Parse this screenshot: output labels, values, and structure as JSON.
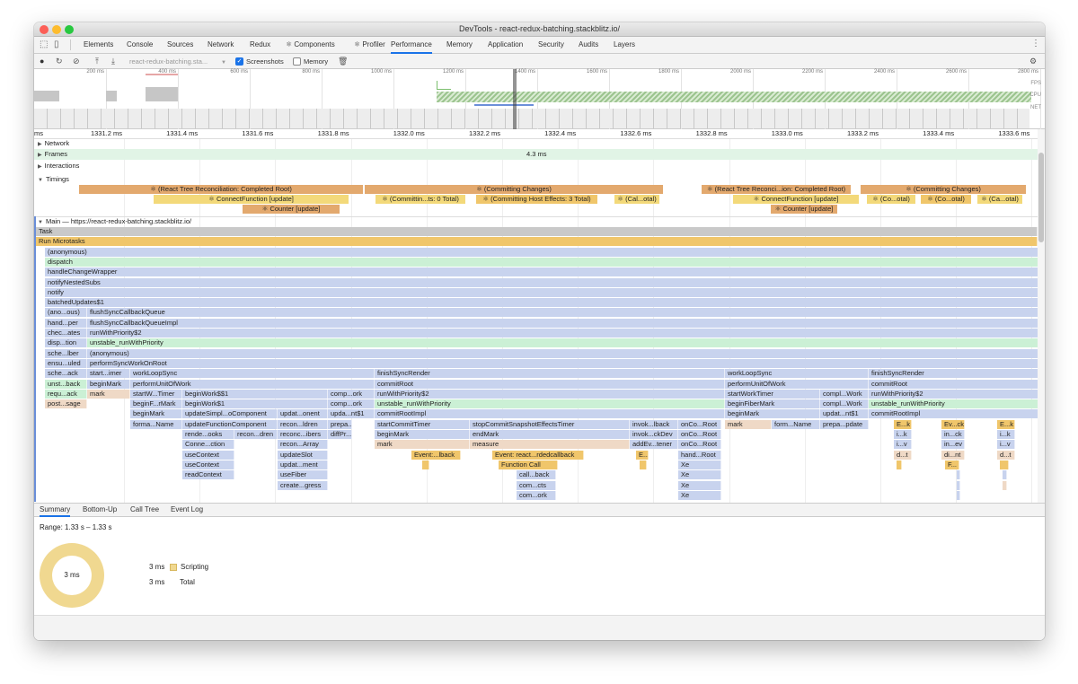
{
  "window": {
    "title": "DevTools - react-redux-batching.stackblitz.io/"
  },
  "tabs": [
    "Elements",
    "Console",
    "Sources",
    "Network",
    "Redux",
    "⚛ Components",
    "⚛ Profiler",
    "Performance",
    "Memory",
    "Application",
    "Security",
    "Audits",
    "Layers"
  ],
  "toolbar": {
    "url": "react-redux-batching.sta...",
    "screenshots": "Screenshots",
    "memory": "Memory"
  },
  "overview": {
    "ticks": [
      "200 ms",
      "400 ms",
      "600 ms",
      "800 ms",
      "1000 ms",
      "1200 ms",
      "1400 ms",
      "1600 ms",
      "1800 ms",
      "2000 ms",
      "2200 ms",
      "2400 ms",
      "2600 ms",
      "2800 ms"
    ],
    "fps": "FPS",
    "cpu": "CPU",
    "net": "NET"
  },
  "ruler": [
    "ms",
    "1331.2 ms",
    "1331.4 ms",
    "1331.6 ms",
    "1331.8 ms",
    "1332.0 ms",
    "1332.2 ms",
    "1332.4 ms",
    "1332.6 ms",
    "1332.8 ms",
    "1333.0 ms",
    "1333.2 ms",
    "1333.4 ms",
    "1333.6 ms"
  ],
  "tracks": {
    "network": "Network",
    "frames": "Frames",
    "frames_duration": "4.3 ms",
    "interactions": "Interactions",
    "timings": "Timings",
    "main": "Main — https://react-redux-batching.stackblitz.io/"
  },
  "timings": [
    {
      "row": 0,
      "l": 50,
      "w": 316,
      "t": "⚛ (React Tree Reconciliation: Completed Root)",
      "c": "#e3a96e"
    },
    {
      "row": 0,
      "l": 368,
      "w": 332,
      "t": "⚛ (Committing Changes)",
      "c": "#e3a96e"
    },
    {
      "row": 0,
      "l": 743,
      "w": 166,
      "t": "⚛ (React Tree Reconci...ion: Completed Root)",
      "c": "#e3a96e"
    },
    {
      "row": 0,
      "l": 920,
      "w": 184,
      "t": "⚛ (Committing Changes)",
      "c": "#e3a96e"
    },
    {
      "row": 1,
      "l": 133,
      "w": 217,
      "t": "⚛ ConnectFunction [update]",
      "c": "#f3d97a"
    },
    {
      "row": 1,
      "l": 380,
      "w": 100,
      "t": "⚛ (Committin...ts: 0 Total)",
      "c": "#f3d97a"
    },
    {
      "row": 1,
      "l": 492,
      "w": 135,
      "t": "⚛ (Committing Host Effects: 3 Total)",
      "c": "#f0c66b"
    },
    {
      "row": 1,
      "l": 646,
      "w": 50,
      "t": "⚛ (Cal...otal)",
      "c": "#f3d97a"
    },
    {
      "row": 1,
      "l": 778,
      "w": 140,
      "t": "⚛ ConnectFunction [update]",
      "c": "#f3d97a"
    },
    {
      "row": 1,
      "l": 927,
      "w": 54,
      "t": "⚛ (Co...otal)",
      "c": "#f3d97a"
    },
    {
      "row": 1,
      "l": 987,
      "w": 56,
      "t": "⚛ (Co...otal)",
      "c": "#f0c66b"
    },
    {
      "row": 1,
      "l": 1050,
      "w": 50,
      "t": "⚛ (Ca...otal)",
      "c": "#f3d97a"
    },
    {
      "row": 2,
      "l": 232,
      "w": 108,
      "t": "⚛ Counter [update]",
      "c": "#e3a96e"
    },
    {
      "row": 2,
      "l": 820,
      "w": 74,
      "t": "⚛ Counter [update]",
      "c": "#e3a96e"
    }
  ],
  "flame": [
    {
      "row": 0,
      "l": 0,
      "w": 1117,
      "t": "Task",
      "c": "gy"
    },
    {
      "row": 1,
      "l": 0,
      "w": 1117,
      "t": "Run Microtasks",
      "c": "or"
    },
    {
      "row": 2,
      "l": 10,
      "w": 1107,
      "t": "(anonymous)",
      "c": "bl"
    },
    {
      "row": 3,
      "l": 10,
      "w": 1107,
      "t": "dispatch",
      "c": "gr"
    },
    {
      "row": 4,
      "l": 10,
      "w": 1107,
      "t": "handleChangeWrapper",
      "c": "bl"
    },
    {
      "row": 5,
      "l": 10,
      "w": 1107,
      "t": "notifyNestedSubs",
      "c": "bl"
    },
    {
      "row": 6,
      "l": 10,
      "w": 1107,
      "t": "notify",
      "c": "bl"
    },
    {
      "row": 7,
      "l": 10,
      "w": 1107,
      "t": "batchedUpdates$1",
      "c": "bl"
    },
    {
      "row": 8,
      "l": 10,
      "w": 47,
      "t": "(ano...ous)",
      "c": "bl"
    },
    {
      "row": 8,
      "l": 57,
      "w": 1060,
      "t": "flushSyncCallbackQueue",
      "c": "bl"
    },
    {
      "row": 9,
      "l": 10,
      "w": 47,
      "t": "hand...per",
      "c": "bl"
    },
    {
      "row": 9,
      "l": 57,
      "w": 1060,
      "t": "flushSyncCallbackQueueImpl",
      "c": "bl"
    },
    {
      "row": 10,
      "l": 10,
      "w": 47,
      "t": "chec...ates",
      "c": "bl"
    },
    {
      "row": 10,
      "l": 57,
      "w": 1060,
      "t": "runWithPriority$2",
      "c": "bl"
    },
    {
      "row": 11,
      "l": 10,
      "w": 47,
      "t": "disp...tion",
      "c": "bl"
    },
    {
      "row": 11,
      "l": 57,
      "w": 1060,
      "t": "unstable_runWithPriority",
      "c": "gr"
    },
    {
      "row": 12,
      "l": 10,
      "w": 47,
      "t": "sche...lber",
      "c": "bl"
    },
    {
      "row": 12,
      "l": 57,
      "w": 1060,
      "t": "(anonymous)",
      "c": "bl"
    },
    {
      "row": 13,
      "l": 10,
      "w": 47,
      "t": "ensu...uled",
      "c": "bl"
    },
    {
      "row": 13,
      "l": 57,
      "w": 1060,
      "t": "performSyncWorkOnRoot",
      "c": "bl"
    },
    {
      "row": 14,
      "l": 10,
      "w": 47,
      "t": "sche...ack",
      "c": "bl"
    },
    {
      "row": 14,
      "l": 57,
      "w": 48,
      "t": "start...imer",
      "c": "bl"
    },
    {
      "row": 14,
      "l": 105,
      "w": 272,
      "t": "workLoopSync",
      "c": "bl"
    },
    {
      "row": 14,
      "l": 377,
      "w": 390,
      "t": "finishSyncRender",
      "c": "bl"
    },
    {
      "row": 14,
      "l": 767,
      "w": 160,
      "t": "workLoopSync",
      "c": "bl"
    },
    {
      "row": 14,
      "l": 927,
      "w": 190,
      "t": "finishSyncRender",
      "c": "bl"
    },
    {
      "row": 15,
      "l": 10,
      "w": 47,
      "t": "unst...back",
      "c": "gr"
    },
    {
      "row": 15,
      "l": 57,
      "w": 48,
      "t": "beginMark",
      "c": "bl"
    },
    {
      "row": 15,
      "l": 105,
      "w": 272,
      "t": "performUnitOfWork",
      "c": "bl"
    },
    {
      "row": 15,
      "l": 377,
      "w": 390,
      "t": "commitRoot",
      "c": "bl"
    },
    {
      "row": 15,
      "l": 767,
      "w": 160,
      "t": "performUnitOfWork",
      "c": "bl"
    },
    {
      "row": 15,
      "l": 927,
      "w": 190,
      "t": "commitRoot",
      "c": "bl"
    },
    {
      "row": 16,
      "l": 10,
      "w": 47,
      "t": "requ...ack",
      "c": "gr"
    },
    {
      "row": 16,
      "l": 57,
      "w": 48,
      "t": "mark",
      "c": "pe"
    },
    {
      "row": 16,
      "l": 105,
      "w": 58,
      "t": "startW...Timer",
      "c": "bl"
    },
    {
      "row": 16,
      "l": 163,
      "w": 162,
      "t": "beginWork$$1",
      "c": "bl"
    },
    {
      "row": 16,
      "l": 325,
      "w": 52,
      "t": "comp...ork",
      "c": "bl"
    },
    {
      "row": 16,
      "l": 377,
      "w": 390,
      "t": "runWithPriority$2",
      "c": "bl"
    },
    {
      "row": 16,
      "l": 767,
      "w": 106,
      "t": "startWorkTimer",
      "c": "bl"
    },
    {
      "row": 16,
      "l": 873,
      "w": 54,
      "t": "compl...Work",
      "c": "bl"
    },
    {
      "row": 16,
      "l": 927,
      "w": 190,
      "t": "runWithPriority$2",
      "c": "bl"
    },
    {
      "row": 17,
      "l": 10,
      "w": 47,
      "t": "post...sage",
      "c": "pe"
    },
    {
      "row": 17,
      "l": 105,
      "w": 58,
      "t": "beginF...rMark",
      "c": "bl"
    },
    {
      "row": 17,
      "l": 163,
      "w": 162,
      "t": "beginWork$1",
      "c": "bl"
    },
    {
      "row": 17,
      "l": 325,
      "w": 52,
      "t": "comp...ork",
      "c": "bl"
    },
    {
      "row": 17,
      "l": 377,
      "w": 390,
      "t": "unstable_runWithPriority",
      "c": "gr"
    },
    {
      "row": 17,
      "l": 767,
      "w": 106,
      "t": "beginFiberMark",
      "c": "bl"
    },
    {
      "row": 17,
      "l": 873,
      "w": 54,
      "t": "compl...Work",
      "c": "bl"
    },
    {
      "row": 17,
      "l": 927,
      "w": 190,
      "t": "unstable_runWithPriority",
      "c": "gr"
    },
    {
      "row": 18,
      "l": 105,
      "w": 58,
      "t": "beginMark",
      "c": "bl"
    },
    {
      "row": 18,
      "l": 163,
      "w": 106,
      "t": "updateSimpl...oComponent",
      "c": "bl"
    },
    {
      "row": 18,
      "l": 269,
      "w": 56,
      "t": "updat...onent",
      "c": "bl"
    },
    {
      "row": 18,
      "l": 325,
      "w": 52,
      "t": "upda...nt$1",
      "c": "bl"
    },
    {
      "row": 18,
      "l": 377,
      "w": 390,
      "t": "commitRootImpl",
      "c": "bl"
    },
    {
      "row": 18,
      "l": 767,
      "w": 106,
      "t": "beginMark",
      "c": "bl"
    },
    {
      "row": 18,
      "l": 873,
      "w": 54,
      "t": "updat...nt$1",
      "c": "bl"
    },
    {
      "row": 18,
      "l": 927,
      "w": 190,
      "t": "commitRootImpl",
      "c": "bl"
    },
    {
      "row": 19,
      "l": 105,
      "w": 58,
      "t": "forma...Name",
      "c": "bl"
    },
    {
      "row": 19,
      "l": 163,
      "w": 106,
      "t": "updateFunctionComponent",
      "c": "bl"
    },
    {
      "row": 19,
      "l": 269,
      "w": 56,
      "t": "recon...ldren",
      "c": "bl"
    },
    {
      "row": 19,
      "l": 325,
      "w": 27,
      "t": "prepa...date",
      "c": "bl"
    },
    {
      "row": 19,
      "l": 377,
      "w": 106,
      "t": "startCommitTimer",
      "c": "bl"
    },
    {
      "row": 19,
      "l": 483,
      "w": 178,
      "t": "stopCommitSnapshotEffectsTimer",
      "c": "bl"
    },
    {
      "row": 19,
      "l": 661,
      "w": 54,
      "t": "invok...lback",
      "c": "bl"
    },
    {
      "row": 19,
      "l": 715,
      "w": 48,
      "t": "onCo...Root",
      "c": "bl"
    },
    {
      "row": 19,
      "l": 767,
      "w": 52,
      "t": "mark",
      "c": "pe"
    },
    {
      "row": 19,
      "l": 819,
      "w": 54,
      "t": "form...Name",
      "c": "bl"
    },
    {
      "row": 19,
      "l": 873,
      "w": 54,
      "t": "prepa...pdate",
      "c": "bl"
    },
    {
      "row": 19,
      "l": 955,
      "w": 20,
      "t": "E...k",
      "c": "or"
    },
    {
      "row": 19,
      "l": 1008,
      "w": 26,
      "t": "Ev...ck",
      "c": "or"
    },
    {
      "row": 19,
      "l": 1070,
      "w": 20,
      "t": "E...k",
      "c": "or"
    },
    {
      "row": 20,
      "l": 163,
      "w": 58,
      "t": "rende...ooks",
      "c": "bl"
    },
    {
      "row": 20,
      "l": 221,
      "w": 48,
      "t": "recon...dren",
      "c": "bl"
    },
    {
      "row": 20,
      "l": 269,
      "w": 56,
      "t": "reconc...ibers",
      "c": "bl"
    },
    {
      "row": 20,
      "l": 325,
      "w": 27,
      "t": "diffPr...rties",
      "c": "bl"
    },
    {
      "row": 20,
      "l": 377,
      "w": 106,
      "t": "beginMark",
      "c": "bl"
    },
    {
      "row": 20,
      "l": 483,
      "w": 178,
      "t": "endMark",
      "c": "bl"
    },
    {
      "row": 20,
      "l": 661,
      "w": 54,
      "t": "invok...ckDev",
      "c": "bl"
    },
    {
      "row": 20,
      "l": 715,
      "w": 48,
      "t": "onCo...Root",
      "c": "bl"
    },
    {
      "row": 20,
      "l": 955,
      "w": 20,
      "t": "i...k",
      "c": "bl"
    },
    {
      "row": 20,
      "l": 1008,
      "w": 26,
      "t": "in...ck",
      "c": "bl"
    },
    {
      "row": 20,
      "l": 1070,
      "w": 20,
      "t": "i...k",
      "c": "bl"
    },
    {
      "row": 21,
      "l": 163,
      "w": 58,
      "t": "Conne...ction",
      "c": "bl"
    },
    {
      "row": 21,
      "l": 269,
      "w": 56,
      "t": "recon...Array",
      "c": "bl"
    },
    {
      "row": 21,
      "l": 377,
      "w": 106,
      "t": "mark",
      "c": "pe"
    },
    {
      "row": 21,
      "l": 483,
      "w": 178,
      "t": "measure",
      "c": "pe"
    },
    {
      "row": 21,
      "l": 661,
      "w": 54,
      "t": "addEv...tener",
      "c": "bl"
    },
    {
      "row": 21,
      "l": 715,
      "w": 48,
      "t": "onCo...Root",
      "c": "bl"
    },
    {
      "row": 21,
      "l": 955,
      "w": 20,
      "t": "i...v",
      "c": "bl"
    },
    {
      "row": 21,
      "l": 1008,
      "w": 26,
      "t": "in...ev",
      "c": "bl"
    },
    {
      "row": 21,
      "l": 1070,
      "w": 20,
      "t": "i...v",
      "c": "bl"
    },
    {
      "row": 22,
      "l": 163,
      "w": 58,
      "t": "useContext",
      "c": "bl"
    },
    {
      "row": 22,
      "l": 269,
      "w": 56,
      "t": "updateSlot",
      "c": "bl"
    },
    {
      "row": 22,
      "l": 418,
      "w": 55,
      "t": "Event:...lback",
      "c": "or"
    },
    {
      "row": 22,
      "l": 508,
      "w": 102,
      "t": "Event: react...rdedcallback",
      "c": "or"
    },
    {
      "row": 22,
      "l": 668,
      "w": 14,
      "t": "E...",
      "c": "or"
    },
    {
      "row": 22,
      "l": 715,
      "w": 48,
      "t": "hand...Root",
      "c": "bl"
    },
    {
      "row": 22,
      "l": 955,
      "w": 20,
      "t": "d...t",
      "c": "pe"
    },
    {
      "row": 22,
      "l": 1008,
      "w": 26,
      "t": "di...nt",
      "c": "pe"
    },
    {
      "row": 22,
      "l": 1070,
      "w": 20,
      "t": "d...t",
      "c": "pe"
    },
    {
      "row": 23,
      "l": 163,
      "w": 58,
      "t": "useContext",
      "c": "bl"
    },
    {
      "row": 23,
      "l": 269,
      "w": 56,
      "t": "updat...ment",
      "c": "bl"
    },
    {
      "row": 23,
      "l": 430,
      "w": 8,
      "t": "",
      "c": "or"
    },
    {
      "row": 23,
      "l": 515,
      "w": 66,
      "t": "Function Call",
      "c": "or"
    },
    {
      "row": 23,
      "l": 672,
      "w": 8,
      "t": "",
      "c": "or"
    },
    {
      "row": 23,
      "l": 715,
      "w": 48,
      "t": "Xe",
      "c": "bl"
    },
    {
      "row": 23,
      "l": 958,
      "w": 6,
      "t": "",
      "c": "or"
    },
    {
      "row": 23,
      "l": 1012,
      "w": 16,
      "t": "F...",
      "c": "or"
    },
    {
      "row": 23,
      "l": 1073,
      "w": 10,
      "t": "",
      "c": "or"
    },
    {
      "row": 24,
      "l": 163,
      "w": 58,
      "t": "readContext",
      "c": "bl"
    },
    {
      "row": 24,
      "l": 269,
      "w": 56,
      "t": "useFiber",
      "c": "bl"
    },
    {
      "row": 24,
      "l": 535,
      "w": 44,
      "t": "call...back",
      "c": "bl"
    },
    {
      "row": 24,
      "l": 715,
      "w": 48,
      "t": "Xe",
      "c": "bl"
    },
    {
      "row": 24,
      "l": 1025,
      "w": 3,
      "t": "",
      "c": "bl"
    },
    {
      "row": 24,
      "l": 1076,
      "w": 5,
      "t": "",
      "c": "bl"
    },
    {
      "row": 25,
      "l": 269,
      "w": 56,
      "t": "create...gress",
      "c": "bl"
    },
    {
      "row": 25,
      "l": 535,
      "w": 44,
      "t": "com...cts",
      "c": "bl"
    },
    {
      "row": 25,
      "l": 715,
      "w": 48,
      "t": "Xe",
      "c": "bl"
    },
    {
      "row": 25,
      "l": 1025,
      "w": 3,
      "t": "",
      "c": "bl"
    },
    {
      "row": 25,
      "l": 1076,
      "w": 5,
      "t": "",
      "c": "pe"
    },
    {
      "row": 26,
      "l": 535,
      "w": 44,
      "t": "com...ork",
      "c": "bl"
    },
    {
      "row": 26,
      "l": 715,
      "w": 48,
      "t": "Xe",
      "c": "bl"
    },
    {
      "row": 26,
      "l": 1025,
      "w": 3,
      "t": "",
      "c": "bl"
    }
  ],
  "bottom": {
    "tabs": [
      "Summary",
      "Bottom-Up",
      "Call Tree",
      "Event Log"
    ],
    "range": "Range: 1.33 s – 1.33 s",
    "donut_label": "3 ms",
    "legend": [
      {
        "value": "3 ms",
        "label": "Scripting",
        "color": "#f0d890"
      },
      {
        "value": "3 ms",
        "label": "Total",
        "color": ""
      }
    ]
  }
}
